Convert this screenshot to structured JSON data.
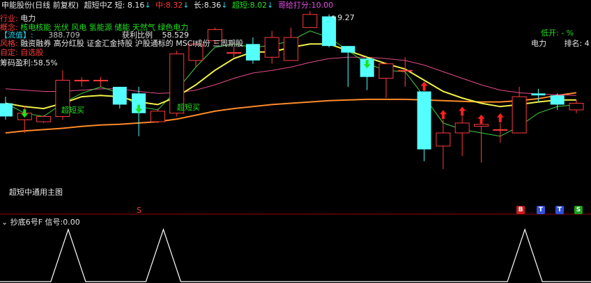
{
  "header": {
    "title": "申能股份(日线 前复权)",
    "indicator": "超短中Z",
    "short_label": "短:",
    "short_value": "8.16",
    "mid_label": "中:",
    "mid_value": "8.32",
    "long_label": "长:",
    "long_value": "8.36",
    "ultra_label": "超短:",
    "ultra_value": "8.02",
    "score_label": "哥给打分:",
    "score_value": "10.00"
  },
  "info": {
    "industry_label": "行业:",
    "industry_value": "电力",
    "concept_label": "概念:",
    "concept_value": "核电核能 光伏 风电 氢能源 储能 天然气 绿色电力",
    "float_label": "【流值】:",
    "float_value": "388.709",
    "ratio_label": "获利比例",
    "ratio_value": "58.529",
    "style_label": "风格:",
    "style_value": "融资融券 高分红股 证金汇金持股 沪股通标的 MSCI成份 三周期股",
    "custom_label": "自定:",
    "custom_value": "自选股",
    "chip_label": "筹码盈利:",
    "chip_value": "58.5%",
    "open_low_label": "低开:",
    "open_low_value": "- %",
    "sector_value": "电力",
    "rank_label": "排名:",
    "rank_value": "4"
  },
  "annotations": {
    "high_price": "9.27",
    "buy_1": "超短买",
    "buy_2": "超短买",
    "main_chart_name": "超短中通用主图",
    "s_marker": "S"
  },
  "buttons": [
    {
      "label": "B",
      "color": "#d01818"
    },
    {
      "label": "T",
      "color": "#3050d8"
    },
    {
      "label": "T",
      "color": "#3050d8"
    },
    {
      "label": "S",
      "color": "#19a019"
    }
  ],
  "sub_panel": {
    "title": "抄底6号F",
    "signal_label": "信号:",
    "signal_value": "0.00"
  },
  "colors": {
    "up": "#ff3b3b",
    "down": "#54ffff",
    "ma_short": "#f2f24a",
    "ma_mid": "#e64b8c",
    "ma_long": "#ff8a2a",
    "ma_ultra": "#40d040"
  },
  "chart_data": {
    "type": "candlestick",
    "price_range": [
      6.6,
      9.6
    ],
    "candles": [
      {
        "o": 8.2,
        "c": 8.0,
        "h": 8.3,
        "l": 7.95
      },
      {
        "o": 7.95,
        "c": 8.05,
        "h": 8.15,
        "l": 7.75
      },
      {
        "o": 7.92,
        "c": 8.0,
        "h": 8.02,
        "l": 7.9
      },
      {
        "o": 8.0,
        "c": 8.55,
        "h": 8.7,
        "l": 7.95
      },
      {
        "o": 8.55,
        "c": 8.55,
        "h": 8.6,
        "l": 8.45
      },
      {
        "o": 8.55,
        "c": 8.55,
        "h": 8.6,
        "l": 8.45
      },
      {
        "o": 8.45,
        "c": 8.18,
        "h": 8.45,
        "l": 8.12
      },
      {
        "o": 8.35,
        "c": 8.05,
        "h": 8.45,
        "l": 7.7
      },
      {
        "o": 7.92,
        "c": 8.08,
        "h": 8.12,
        "l": 7.9
      },
      {
        "o": 8.05,
        "c": 8.95,
        "h": 9.0,
        "l": 8.0
      },
      {
        "o": 8.85,
        "c": 9.1,
        "h": 9.15,
        "l": 8.75
      },
      {
        "o": 9.15,
        "c": 9.32,
        "h": 9.35,
        "l": 9.1
      },
      {
        "o": 8.97,
        "c": 8.97,
        "h": 9.05,
        "l": 8.9
      },
      {
        "o": 9.1,
        "c": 8.85,
        "h": 9.2,
        "l": 8.8
      },
      {
        "o": 8.9,
        "c": 9.2,
        "h": 9.3,
        "l": 8.8
      },
      {
        "o": 8.85,
        "c": 9.2,
        "h": 9.35,
        "l": 8.85
      },
      {
        "o": 9.35,
        "c": 9.55,
        "h": 9.6,
        "l": 9.35
      },
      {
        "o": 9.52,
        "c": 9.07,
        "h": 9.55,
        "l": 9.05
      },
      {
        "o": 9.07,
        "c": 8.97,
        "h": 9.07,
        "l": 8.45
      },
      {
        "o": 8.88,
        "c": 8.6,
        "h": 8.9,
        "l": 8.4
      },
      {
        "o": 8.58,
        "c": 8.8,
        "h": 8.82,
        "l": 8.28
      },
      {
        "o": 8.7,
        "c": 8.7,
        "h": 8.9,
        "l": 8.45
      },
      {
        "o": 8.38,
        "c": 7.5,
        "h": 8.38,
        "l": 7.32
      },
      {
        "o": 7.55,
        "c": 7.75,
        "h": 7.95,
        "l": 7.2
      },
      {
        "o": 7.75,
        "c": 7.9,
        "h": 8.0,
        "l": 7.4
      },
      {
        "o": 7.85,
        "c": 7.88,
        "h": 7.88,
        "l": 7.3
      },
      {
        "o": 7.8,
        "c": 7.8,
        "h": 7.9,
        "l": 7.6
      },
      {
        "o": 7.75,
        "c": 8.3,
        "h": 8.45,
        "l": 7.75
      },
      {
        "o": 8.35,
        "c": 8.32,
        "h": 8.42,
        "l": 8.22
      },
      {
        "o": 8.32,
        "c": 8.18,
        "h": 8.35,
        "l": 8.1
      },
      {
        "o": 8.1,
        "c": 8.2,
        "h": 8.25,
        "l": 8.05
      }
    ],
    "ma_short": [
      8.2,
      8.15,
      8.12,
      8.2,
      8.3,
      8.32,
      8.3,
      8.22,
      8.18,
      8.3,
      8.48,
      8.7,
      8.88,
      8.98,
      8.98,
      9.05,
      9.1,
      9.1,
      9.0,
      8.9,
      8.8,
      8.72,
      8.55,
      8.38,
      8.28,
      8.2,
      8.15,
      8.18,
      8.22,
      8.25,
      8.25
    ],
    "ma_mid": [
      8.42,
      8.4,
      8.38,
      8.38,
      8.4,
      8.42,
      8.42,
      8.38,
      8.35,
      8.36,
      8.4,
      8.48,
      8.58,
      8.66,
      8.7,
      8.75,
      8.82,
      8.88,
      8.9,
      8.9,
      8.88,
      8.85,
      8.78,
      8.68,
      8.58,
      8.48,
      8.4,
      8.36,
      8.34,
      8.33,
      8.32
    ],
    "ma_long": [
      7.75,
      7.78,
      7.8,
      7.82,
      7.85,
      7.87,
      7.88,
      7.9,
      7.92,
      7.96,
      8.02,
      8.08,
      8.12,
      8.15,
      8.18,
      8.2,
      8.22,
      8.24,
      8.25,
      8.26,
      8.26,
      8.26,
      8.25,
      8.24,
      8.23,
      8.22,
      8.22,
      8.24,
      8.27,
      8.32,
      8.36
    ],
    "ma_ultra": [
      8.2,
      8.05,
      8.0,
      8.2,
      8.35,
      8.45,
      8.35,
      8.15,
      8.1,
      8.4,
      8.75,
      9.05,
      9.1,
      9.05,
      9.08,
      9.15,
      9.3,
      9.2,
      9.0,
      8.8,
      8.7,
      8.68,
      8.3,
      7.9,
      7.8,
      7.75,
      7.7,
      7.85,
      8.05,
      8.15,
      8.18
    ],
    "signal": [
      0,
      0,
      0,
      1,
      0,
      0,
      0,
      0,
      1,
      0,
      0,
      0,
      0,
      0,
      0,
      0,
      0,
      0,
      0,
      0,
      0,
      0,
      0,
      0,
      0,
      0,
      0,
      1,
      0,
      0,
      0
    ]
  }
}
